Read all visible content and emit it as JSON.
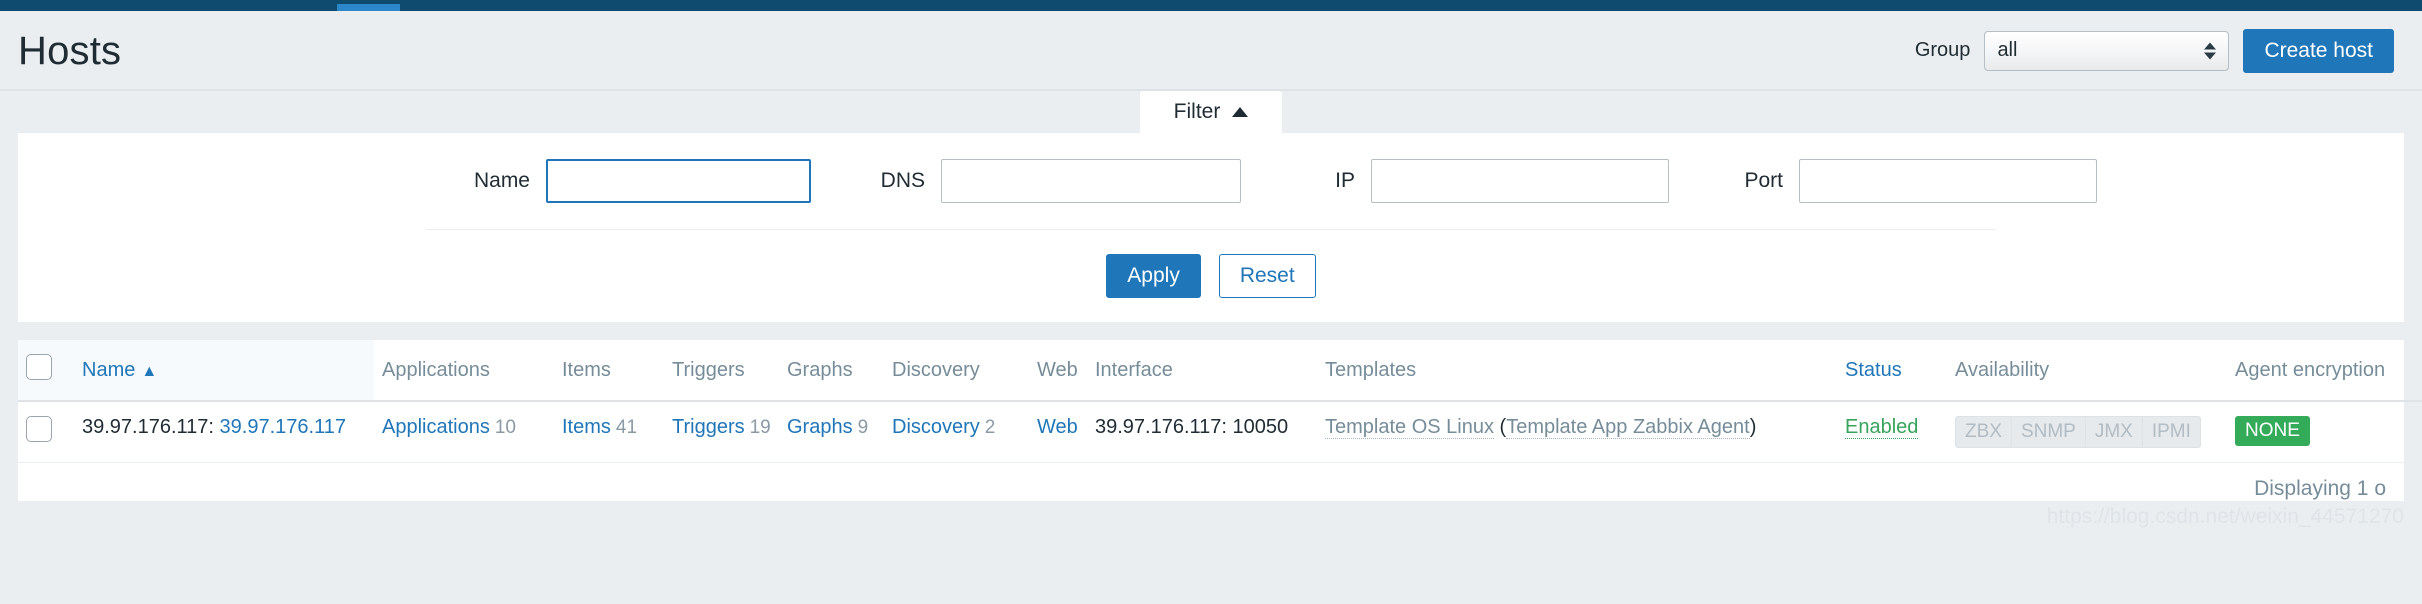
{
  "topnav": {
    "accent_color": "#2b87c9",
    "bar_color": "#0f4b6e"
  },
  "header": {
    "title": "Hosts",
    "group_label": "Group",
    "group_value": "all",
    "create_host_label": "Create host"
  },
  "filter": {
    "tab_label": "Filter",
    "fields": [
      {
        "label": "Name",
        "value": "",
        "placeholder": "",
        "focused": true
      },
      {
        "label": "DNS",
        "value": "",
        "placeholder": "",
        "focused": false
      },
      {
        "label": "IP",
        "value": "",
        "placeholder": "",
        "focused": false
      },
      {
        "label": "Port",
        "value": "",
        "placeholder": "",
        "focused": false
      }
    ],
    "apply_label": "Apply",
    "reset_label": "Reset"
  },
  "table": {
    "columns": [
      {
        "label": "Name",
        "sortable": true,
        "sorted": true,
        "sort_dir": "asc"
      },
      {
        "label": "Applications",
        "sortable": false,
        "sorted": false
      },
      {
        "label": "Items",
        "sortable": false,
        "sorted": false
      },
      {
        "label": "Triggers",
        "sortable": false,
        "sorted": false
      },
      {
        "label": "Graphs",
        "sortable": false,
        "sorted": false
      },
      {
        "label": "Discovery",
        "sortable": false,
        "sorted": false
      },
      {
        "label": "Web",
        "sortable": false,
        "sorted": false
      },
      {
        "label": "Interface",
        "sortable": false,
        "sorted": false
      },
      {
        "label": "Templates",
        "sortable": false,
        "sorted": false
      },
      {
        "label": "Status",
        "sortable": true,
        "sorted": false
      },
      {
        "label": "Availability",
        "sortable": false,
        "sorted": false
      },
      {
        "label": "Agent encryption",
        "sortable": false,
        "sorted": false
      }
    ],
    "sort_indicator": "▲",
    "rows": [
      {
        "name_prefix": "39.97.176.117:",
        "name_link": "39.97.176.117",
        "applications_label": "Applications",
        "applications_count": "10",
        "items_label": "Items",
        "items_count": "41",
        "triggers_label": "Triggers",
        "triggers_count": "19",
        "graphs_label": "Graphs",
        "graphs_count": "9",
        "discovery_label": "Discovery",
        "discovery_count": "2",
        "web_label": "Web",
        "web_count": "",
        "interface": "39.97.176.117: 10050",
        "template_primary": "Template OS Linux",
        "template_nested": "Template App Zabbix Agent",
        "status": "Enabled",
        "availability": [
          "ZBX",
          "SNMP",
          "JMX",
          "IPMI"
        ],
        "encryption": "NONE"
      }
    ],
    "footer": "Displaying 1 o"
  },
  "watermark": "https://blog.csdn.net/weixin_44571270"
}
